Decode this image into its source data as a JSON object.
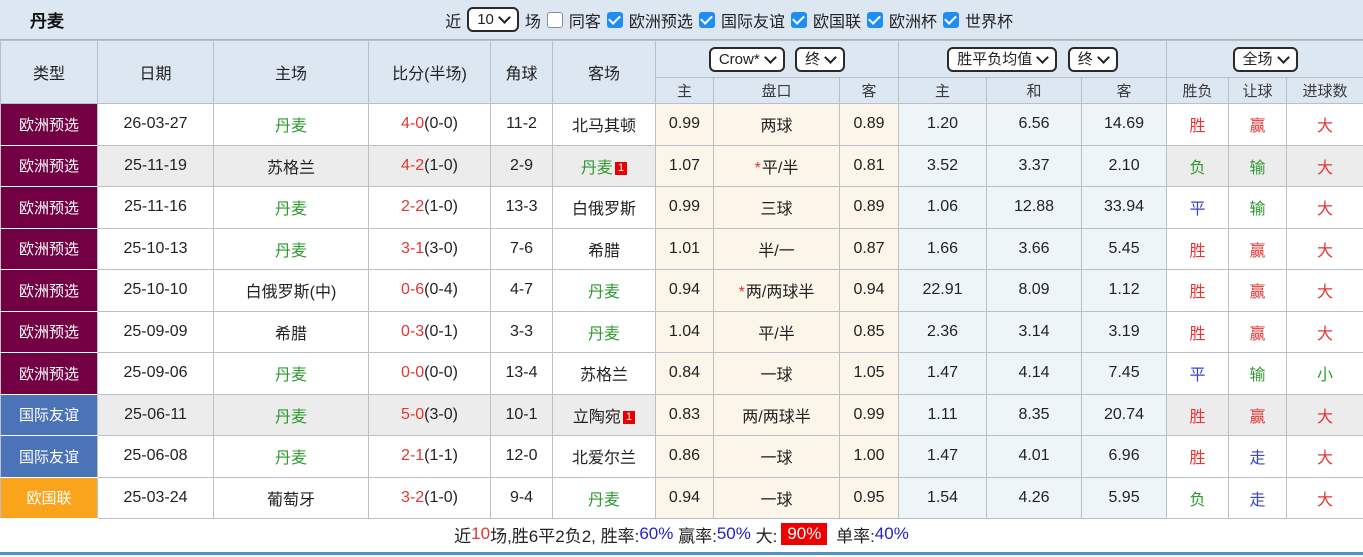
{
  "title": "丹麦",
  "filter": {
    "recent_label": "近",
    "recent_value": "10",
    "matches_label": "场",
    "same_away_label": "同客",
    "same_away_checked": false,
    "leagues": [
      "欧洲预选",
      "国际友谊",
      "欧国联",
      "欧洲杯",
      "世界杯"
    ],
    "leagues_checked": [
      true,
      true,
      true,
      true,
      true
    ]
  },
  "table": {
    "dropdowns": {
      "bookmaker": "Crow*",
      "bookmaker_period": "终",
      "avg": "胜平负均值",
      "avg_period": "终",
      "scope": "全场"
    },
    "headers": {
      "type": "类型",
      "date": "日期",
      "home": "主场",
      "score": "比分(半场)",
      "corner": "角球",
      "away": "客场",
      "odds_home": "主",
      "handicap": "盘口",
      "odds_away": "客",
      "avg_home": "主",
      "avg_draw": "和",
      "avg_away": "客",
      "result": "胜负",
      "handicap_result": "让球",
      "goals": "进球数"
    },
    "rows": [
      {
        "type": "欧洲预选",
        "date": "26-03-27",
        "home": "丹麦",
        "home_is_team": true,
        "score": "4-0",
        "half": "(0-0)",
        "corners": "11-2",
        "away": "北马其顿",
        "away_is_team": false,
        "away_badge": "",
        "odds_home": "0.99",
        "handicap": "两球",
        "handicap_star": false,
        "odds_away": "0.89",
        "avg_home": "1.20",
        "avg_draw": "6.56",
        "avg_away": "14.69",
        "result": "胜",
        "handicap_result": "赢",
        "goals": "大",
        "highlight": false
      },
      {
        "type": "欧洲预选",
        "date": "25-11-19",
        "home": "苏格兰",
        "home_is_team": false,
        "score": "4-2",
        "half": "(1-0)",
        "corners": "2-9",
        "away": "丹麦",
        "away_is_team": true,
        "away_badge": "1",
        "odds_home": "1.07",
        "handicap": "平/半",
        "handicap_star": true,
        "odds_away": "0.81",
        "avg_home": "3.52",
        "avg_draw": "3.37",
        "avg_away": "2.10",
        "result": "负",
        "handicap_result": "输",
        "goals": "大",
        "highlight": true
      },
      {
        "type": "欧洲预选",
        "date": "25-11-16",
        "home": "丹麦",
        "home_is_team": true,
        "score": "2-2",
        "half": "(1-0)",
        "corners": "13-3",
        "away": "白俄罗斯",
        "away_is_team": false,
        "away_badge": "",
        "odds_home": "0.99",
        "handicap": "三球",
        "handicap_star": false,
        "odds_away": "0.89",
        "avg_home": "1.06",
        "avg_draw": "12.88",
        "avg_away": "33.94",
        "result": "平",
        "handicap_result": "输",
        "goals": "大",
        "highlight": false
      },
      {
        "type": "欧洲预选",
        "date": "25-10-13",
        "home": "丹麦",
        "home_is_team": true,
        "score": "3-1",
        "half": "(3-0)",
        "corners": "7-6",
        "away": "希腊",
        "away_is_team": false,
        "away_badge": "",
        "odds_home": "1.01",
        "handicap": "半/一",
        "handicap_star": false,
        "odds_away": "0.87",
        "avg_home": "1.66",
        "avg_draw": "3.66",
        "avg_away": "5.45",
        "result": "胜",
        "handicap_result": "赢",
        "goals": "大",
        "highlight": false
      },
      {
        "type": "欧洲预选",
        "date": "25-10-10",
        "home": "白俄罗斯(中)",
        "home_is_team": false,
        "score": "0-6",
        "half": "(0-4)",
        "corners": "4-7",
        "away": "丹麦",
        "away_is_team": true,
        "away_badge": "",
        "odds_home": "0.94",
        "handicap": "两/两球半",
        "handicap_star": true,
        "odds_away": "0.94",
        "avg_home": "22.91",
        "avg_draw": "8.09",
        "avg_away": "1.12",
        "result": "胜",
        "handicap_result": "赢",
        "goals": "大",
        "highlight": false
      },
      {
        "type": "欧洲预选",
        "date": "25-09-09",
        "home": "希腊",
        "home_is_team": false,
        "score": "0-3",
        "half": "(0-1)",
        "corners": "3-3",
        "away": "丹麦",
        "away_is_team": true,
        "away_badge": "",
        "odds_home": "1.04",
        "handicap": "平/半",
        "handicap_star": false,
        "odds_away": "0.85",
        "avg_home": "2.36",
        "avg_draw": "3.14",
        "avg_away": "3.19",
        "result": "胜",
        "handicap_result": "赢",
        "goals": "大",
        "highlight": false
      },
      {
        "type": "欧洲预选",
        "date": "25-09-06",
        "home": "丹麦",
        "home_is_team": true,
        "score": "0-0",
        "half": "(0-0)",
        "corners": "13-4",
        "away": "苏格兰",
        "away_is_team": false,
        "away_badge": "",
        "odds_home": "0.84",
        "handicap": "一球",
        "handicap_star": false,
        "odds_away": "1.05",
        "avg_home": "1.47",
        "avg_draw": "4.14",
        "avg_away": "7.45",
        "result": "平",
        "handicap_result": "输",
        "goals": "小",
        "highlight": false
      },
      {
        "type": "国际友谊",
        "date": "25-06-11",
        "home": "丹麦",
        "home_is_team": true,
        "score": "5-0",
        "half": "(3-0)",
        "corners": "10-1",
        "away": "立陶宛",
        "away_is_team": false,
        "away_badge": "1",
        "odds_home": "0.83",
        "handicap": "两/两球半",
        "handicap_star": false,
        "odds_away": "0.99",
        "avg_home": "1.11",
        "avg_draw": "8.35",
        "avg_away": "20.74",
        "result": "胜",
        "handicap_result": "赢",
        "goals": "大",
        "highlight": true
      },
      {
        "type": "国际友谊",
        "date": "25-06-08",
        "home": "丹麦",
        "home_is_team": true,
        "score": "2-1",
        "half": "(1-1)",
        "corners": "12-0",
        "away": "北爱尔兰",
        "away_is_team": false,
        "away_badge": "",
        "odds_home": "0.86",
        "handicap": "一球",
        "handicap_star": false,
        "odds_away": "1.00",
        "avg_home": "1.47",
        "avg_draw": "4.01",
        "avg_away": "6.96",
        "result": "胜",
        "handicap_result": "走",
        "goals": "大",
        "highlight": false
      },
      {
        "type": "欧国联",
        "date": "25-03-24",
        "home": "葡萄牙",
        "home_is_team": false,
        "score": "3-2",
        "half": "(1-0)",
        "corners": "9-4",
        "away": "丹麦",
        "away_is_team": true,
        "away_badge": "",
        "odds_home": "0.94",
        "handicap": "一球",
        "handicap_star": false,
        "odds_away": "0.95",
        "avg_home": "1.54",
        "avg_draw": "4.26",
        "avg_away": "5.95",
        "result": "负",
        "handicap_result": "走",
        "goals": "大",
        "highlight": false
      }
    ]
  },
  "competition_colors": {
    "欧洲预选": "#730042",
    "国际友谊": "#4a73b8",
    "欧国联": "#f9a41b"
  },
  "result_colors": {
    "胜": "#e53535",
    "负": "#2e9b2e",
    "平": "#3745d0",
    "赢": "#e53535",
    "输": "#2e9b2e",
    "走": "#3745d0",
    "大": "#e53535",
    "小": "#2e9b2e"
  },
  "team_color": "#2e9b2e",
  "score_color": "#e53535",
  "footer": {
    "segments": [
      {
        "text": "近",
        "style": "plain"
      },
      {
        "text": "10",
        "style": "red"
      },
      {
        "text": "场,胜6平2负2, 胜率:",
        "style": "plain"
      },
      {
        "text": "60%",
        "style": "blue"
      },
      {
        "text": " 赢率:",
        "style": "plain"
      },
      {
        "text": "50%",
        "style": "blue"
      },
      {
        "text": " 大:",
        "style": "plain"
      },
      {
        "text": "90%",
        "style": "badge"
      },
      {
        "text": " 单率:",
        "style": "plain"
      },
      {
        "text": "40%",
        "style": "blue"
      }
    ]
  }
}
